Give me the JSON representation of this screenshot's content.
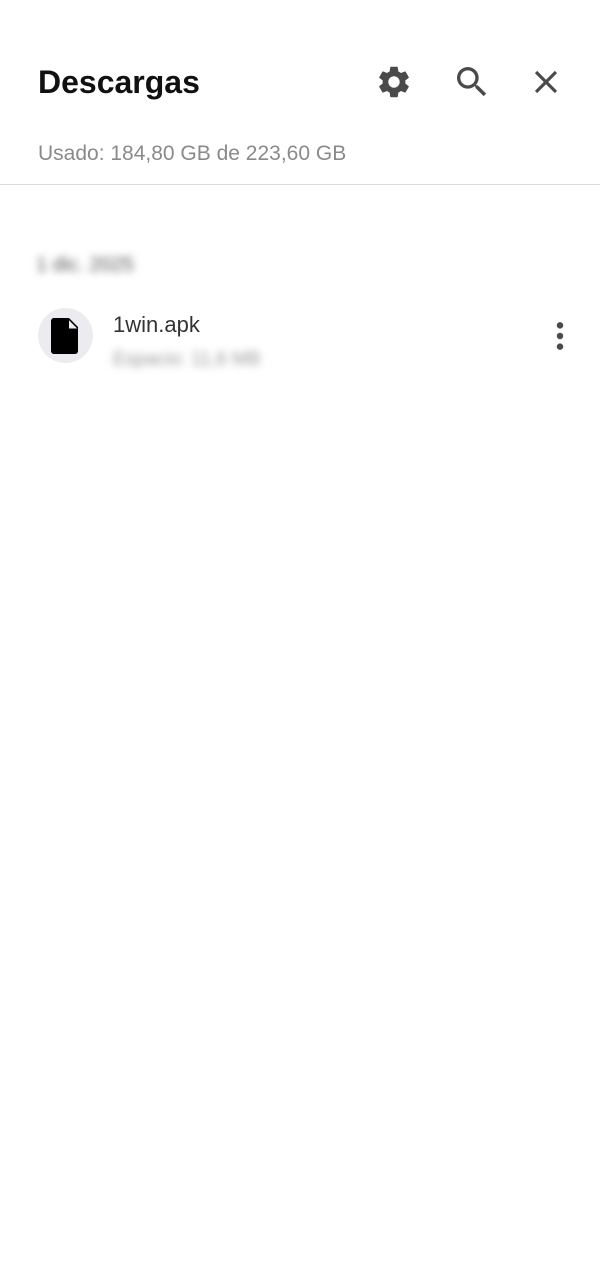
{
  "header": {
    "title": "Descargas",
    "usage": "Usado: 184,80 GB de 223,60 GB",
    "icons": [
      "gear-icon",
      "search-icon",
      "close-icon"
    ]
  },
  "list": {
    "date_header": "1 dic. 2025",
    "items": [
      {
        "name": "1win.apk",
        "details": "Espacio: 11,6 MB",
        "icon": "file-icon",
        "menu_icon": "more-vert-icon"
      }
    ]
  },
  "colors": {
    "icon": "#4a4a4a",
    "avatar_bg": "#ececf0",
    "divider": "#dcdcdc"
  }
}
